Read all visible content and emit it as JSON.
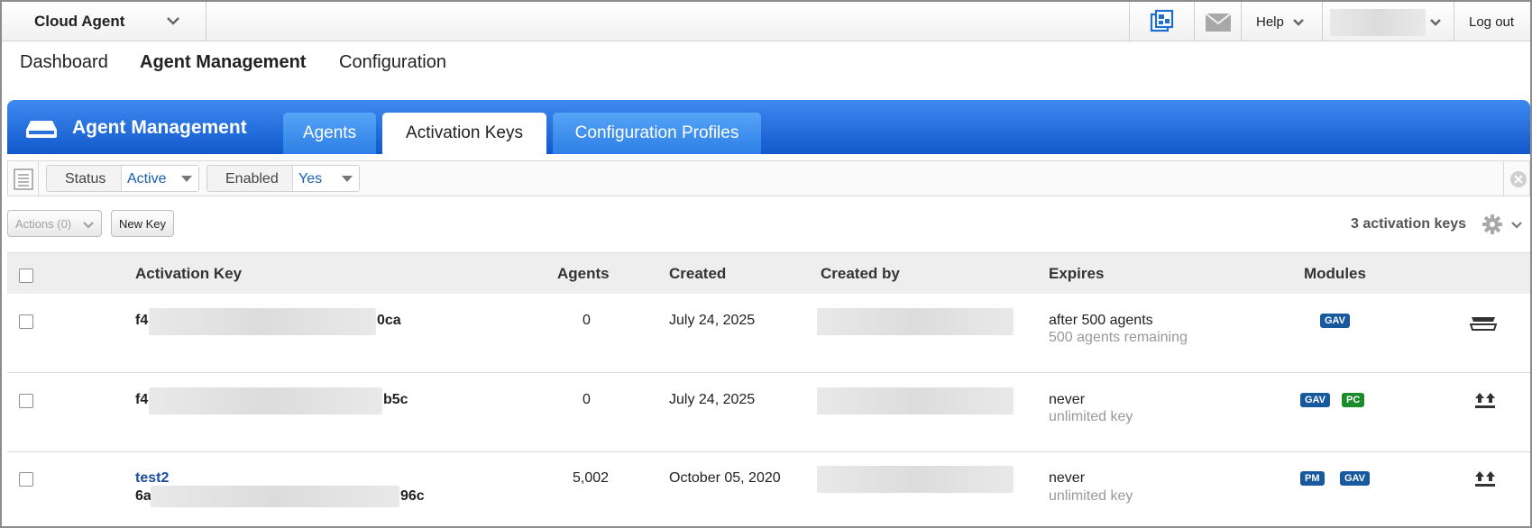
{
  "topbar": {
    "app_name": "Cloud Agent",
    "help_label": "Help",
    "logout_label": "Log out"
  },
  "nav": {
    "items": [
      "Dashboard",
      "Agent Management",
      "Configuration"
    ],
    "active": "Agent Management"
  },
  "module": {
    "title": "Agent Management",
    "tabs": [
      {
        "label": "Agents",
        "active": false
      },
      {
        "label": "Activation Keys",
        "active": true
      },
      {
        "label": "Configuration Profiles",
        "active": false
      }
    ]
  },
  "filters": [
    {
      "label": "Status",
      "value": "Active"
    },
    {
      "label": "Enabled",
      "value": "Yes"
    }
  ],
  "toolbar": {
    "actions_label": "Actions (0)",
    "new_key_label": "New Key",
    "count_label": "3 activation keys"
  },
  "table": {
    "columns": [
      "Activation Key",
      "Agents",
      "Created",
      "Created by",
      "Expires",
      "Modules"
    ],
    "rows": [
      {
        "key_name": "",
        "key_prefix": "f4",
        "key_suffix": "0ca",
        "agents": "0",
        "created": "July 24, 2025",
        "expires": "after 500 agents",
        "expires_sub": "500 agents remaining",
        "modules": [
          "GAV"
        ]
      },
      {
        "key_name": "",
        "key_prefix": "f4",
        "key_suffix": "b5c",
        "agents": "0",
        "created": "July 24, 2025",
        "expires": "never",
        "expires_sub": "unlimited key",
        "modules": [
          "GAV",
          "PC"
        ]
      },
      {
        "key_name": "test2",
        "key_prefix": "6a",
        "key_suffix": "96c",
        "agents": "5,002",
        "created": "October 05, 2020",
        "expires": "never",
        "expires_sub": "unlimited key",
        "modules": [
          "PM",
          "GAV"
        ]
      }
    ]
  },
  "colors": {
    "accent": "#1a5fb4",
    "module_header": "#1258cc",
    "badge_blue": "#17589e",
    "badge_green": "#1a8c2c"
  }
}
